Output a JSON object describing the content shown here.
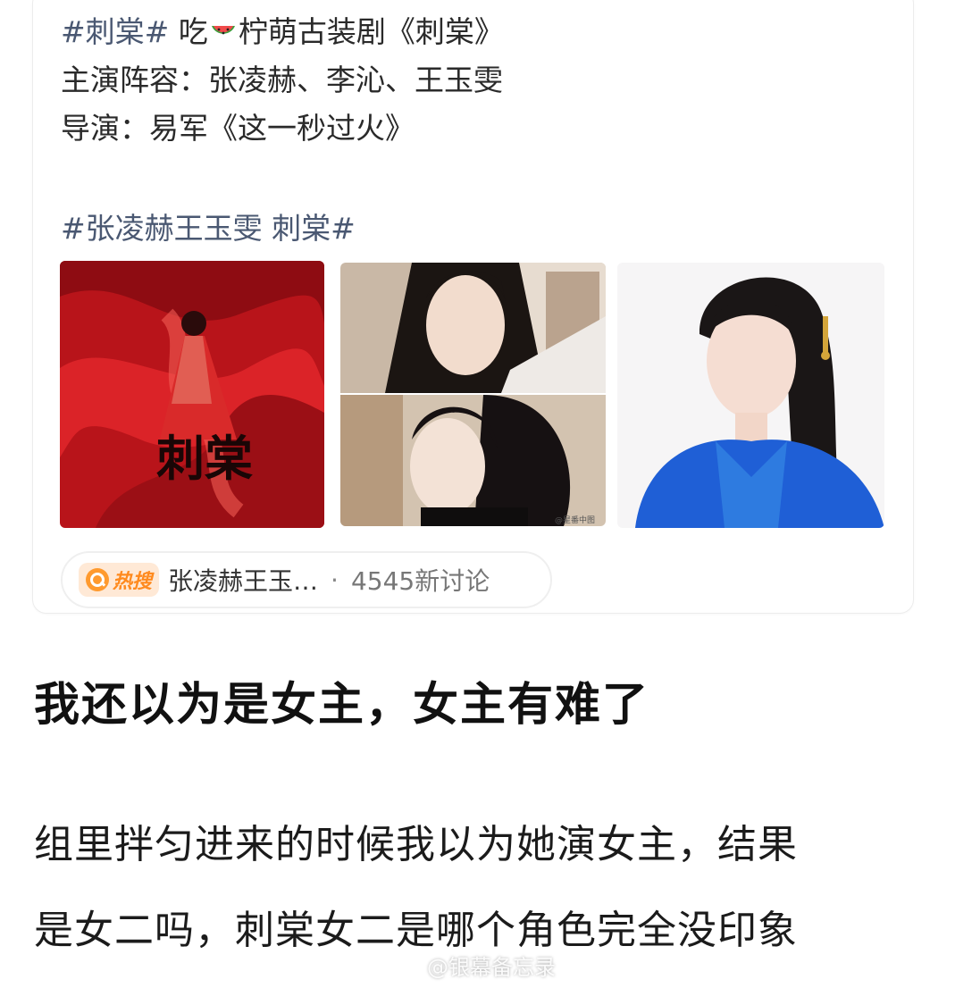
{
  "post": {
    "hashtag1": "#刺棠#",
    "line1_a": " 吃",
    "line1_b": "柠萌古装剧《刺棠》",
    "line2": "主演阵容：张凌赫、李沁、王玉雯",
    "line3": "导演：易军《这一秒过火》",
    "hashtag2": "#张凌赫王玉雯 刺棠#",
    "icons": {
      "emoji": "watermelon-icon"
    }
  },
  "poster": {
    "title_calligraphy": "刺棠",
    "watermark_text": "@星番中图"
  },
  "hot_search": {
    "badge": "热搜",
    "topic": "张凌赫王玉…",
    "separator": "·",
    "count": "4545新讨论"
  },
  "article": {
    "headline": "我还以为是女主，女主有难了",
    "body_line1": "组里拌匀进来的时候我以为她演女主，结果",
    "body_line2": "是女二吗，刺棠女二是哪个角色完全没印象"
  },
  "watermark": {
    "text": "@银幕备忘录"
  },
  "colors": {
    "hashtag": "#4a5872",
    "hot_orange": "#ff8a1e",
    "robe_blue": "#1f5fd6",
    "poster_red": "#c4161c"
  }
}
